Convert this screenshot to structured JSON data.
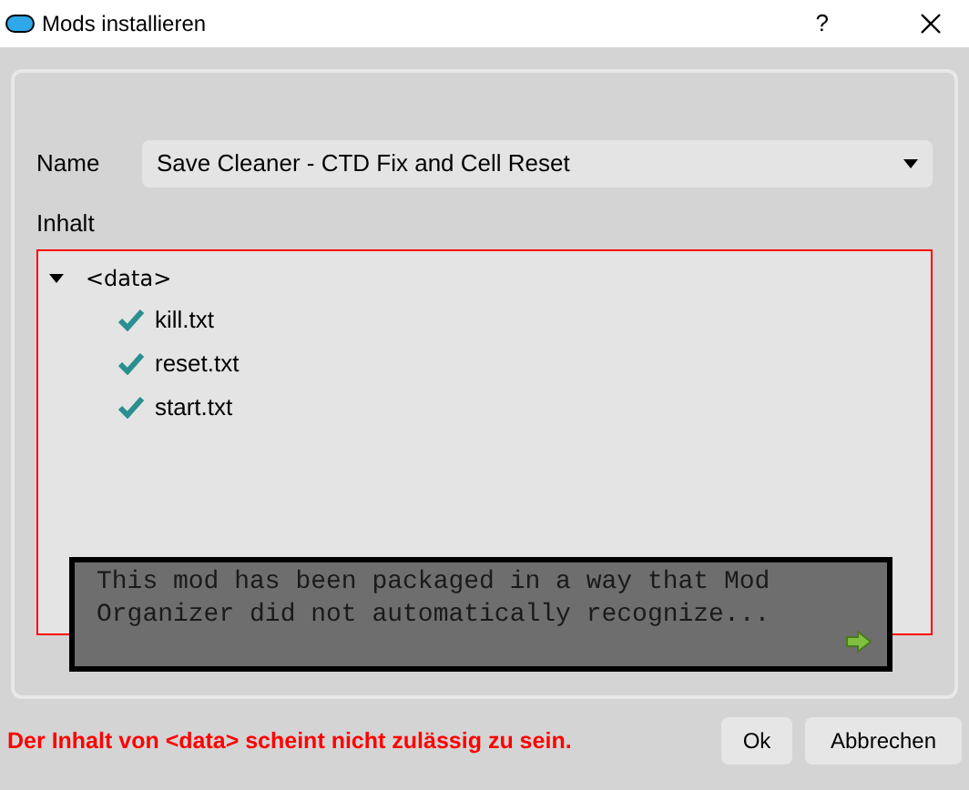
{
  "window": {
    "title": "Mods installieren",
    "help": "?"
  },
  "name_field": {
    "label": "Name",
    "value": "Save Cleaner - CTD Fix and Cell Reset"
  },
  "content": {
    "label": "Inhalt",
    "invalid": true,
    "tree": [
      {
        "label": "<data>",
        "expanded": true,
        "children": [
          {
            "label": "kill.txt",
            "checked": true
          },
          {
            "label": "reset.txt",
            "checked": true
          },
          {
            "label": "start.txt",
            "checked": true
          }
        ]
      }
    ]
  },
  "tooltip": {
    "text": "This mod has been packaged in a way that Mod Organizer did not automatically recognize..."
  },
  "error": "Der Inhalt von <data> scheint nicht zulässig zu sein.",
  "buttons": [
    "Ok",
    "Abbrechen"
  ]
}
